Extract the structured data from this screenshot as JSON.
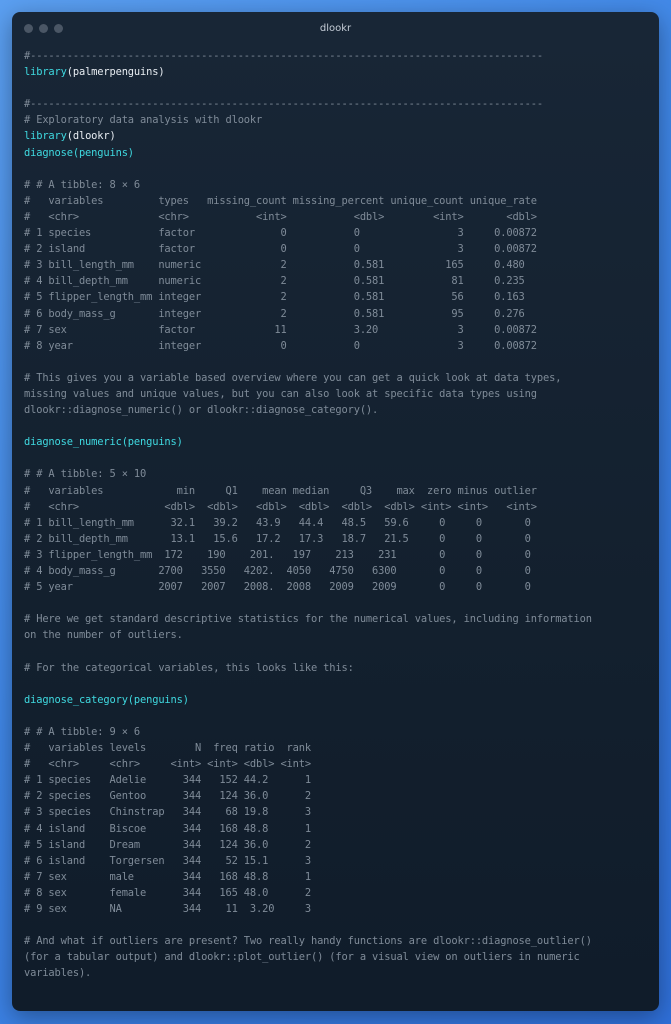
{
  "window": {
    "title": "dlookr"
  },
  "code_lines": [
    {
      "kind": "comment",
      "text": "#------------------------------------------------------------------------------------"
    },
    {
      "kind": "call",
      "fn": "library",
      "arg": "palmerpenguins",
      "fn_color": "cyan"
    },
    {
      "kind": "blank",
      "text": ""
    },
    {
      "kind": "comment",
      "text": "#------------------------------------------------------------------------------------"
    },
    {
      "kind": "comment",
      "text": "# Exploratory data analysis with dlookr"
    },
    {
      "kind": "call",
      "fn": "library",
      "arg": "dlookr",
      "fn_color": "cyan"
    },
    {
      "kind": "call_full",
      "text": "diagnose(penguins)"
    },
    {
      "kind": "blank",
      "text": ""
    },
    {
      "kind": "comment",
      "text": "# # A tibble: 8 × 6"
    },
    {
      "kind": "comment",
      "text": "#   variables         types   missing_count missing_percent unique_count unique_rate"
    },
    {
      "kind": "comment",
      "text": "#   <chr>             <chr>           <int>           <dbl>        <int>       <dbl>"
    },
    {
      "kind": "comment",
      "text": "# 1 species           factor              0           0                3     0.00872"
    },
    {
      "kind": "comment",
      "text": "# 2 island            factor              0           0                3     0.00872"
    },
    {
      "kind": "comment",
      "text": "# 3 bill_length_mm    numeric             2           0.581          165     0.480"
    },
    {
      "kind": "comment",
      "text": "# 4 bill_depth_mm     numeric             2           0.581           81     0.235"
    },
    {
      "kind": "comment",
      "text": "# 5 flipper_length_mm integer             2           0.581           56     0.163"
    },
    {
      "kind": "comment",
      "text": "# 6 body_mass_g       integer             2           0.581           95     0.276"
    },
    {
      "kind": "comment",
      "text": "# 7 sex               factor             11           3.20             3     0.00872"
    },
    {
      "kind": "comment",
      "text": "# 8 year              integer             0           0                3     0.00872"
    },
    {
      "kind": "blank",
      "text": ""
    },
    {
      "kind": "comment",
      "text": "# This gives you a variable based overview where you can get a quick look at data types,"
    },
    {
      "kind": "comment",
      "text": "missing values and unique values, but you can also look at specific data types using"
    },
    {
      "kind": "comment",
      "text": "dlookr::diagnose_numeric() or dlookr::diagnose_category()."
    },
    {
      "kind": "blank",
      "text": ""
    },
    {
      "kind": "call_full",
      "text": "diagnose_numeric(penguins)"
    },
    {
      "kind": "blank",
      "text": ""
    },
    {
      "kind": "comment",
      "text": "# # A tibble: 5 × 10"
    },
    {
      "kind": "comment",
      "text": "#   variables            min     Q1    mean median     Q3    max  zero minus outlier"
    },
    {
      "kind": "comment",
      "text": "#   <chr>              <dbl>  <dbl>   <dbl>  <dbl>  <dbl>  <dbl> <int> <int>   <int>"
    },
    {
      "kind": "comment",
      "text": "# 1 bill_length_mm      32.1   39.2   43.9   44.4   48.5   59.6     0     0       0"
    },
    {
      "kind": "comment",
      "text": "# 2 bill_depth_mm       13.1   15.6   17.2   17.3   18.7   21.5     0     0       0"
    },
    {
      "kind": "comment",
      "text": "# 3 flipper_length_mm  172    190    201.   197    213    231       0     0       0"
    },
    {
      "kind": "comment",
      "text": "# 4 body_mass_g       2700   3550   4202.  4050   4750   6300       0     0       0"
    },
    {
      "kind": "comment",
      "text": "# 5 year              2007   2007   2008.  2008   2009   2009       0     0       0"
    },
    {
      "kind": "blank",
      "text": ""
    },
    {
      "kind": "comment",
      "text": "# Here we get standard descriptive statistics for the numerical values, including information"
    },
    {
      "kind": "comment",
      "text": "on the number of outliers."
    },
    {
      "kind": "blank",
      "text": ""
    },
    {
      "kind": "comment",
      "text": "# For the categorical variables, this looks like this:"
    },
    {
      "kind": "blank",
      "text": ""
    },
    {
      "kind": "call_full",
      "text": "diagnose_category(penguins)"
    },
    {
      "kind": "blank",
      "text": ""
    },
    {
      "kind": "comment",
      "text": "# # A tibble: 9 × 6"
    },
    {
      "kind": "comment",
      "text": "#   variables levels        N  freq ratio  rank"
    },
    {
      "kind": "comment",
      "text": "#   <chr>     <chr>     <int> <int> <dbl> <int>"
    },
    {
      "kind": "comment",
      "text": "# 1 species   Adelie      344   152 44.2      1"
    },
    {
      "kind": "comment",
      "text": "# 2 species   Gentoo      344   124 36.0      2"
    },
    {
      "kind": "comment",
      "text": "# 3 species   Chinstrap   344    68 19.8      3"
    },
    {
      "kind": "comment",
      "text": "# 4 island    Biscoe      344   168 48.8      1"
    },
    {
      "kind": "comment",
      "text": "# 5 island    Dream       344   124 36.0      2"
    },
    {
      "kind": "comment",
      "text": "# 6 island    Torgersen   344    52 15.1      3"
    },
    {
      "kind": "comment",
      "text": "# 7 sex       male        344   168 48.8      1"
    },
    {
      "kind": "comment",
      "text": "# 8 sex       female      344   165 48.0      2"
    },
    {
      "kind": "comment",
      "text": "# 9 sex       NA          344    11  3.20     3"
    },
    {
      "kind": "blank",
      "text": ""
    },
    {
      "kind": "comment",
      "text": "# And what if outliers are present? Two really handy functions are dlookr::diagnose_outlier()"
    },
    {
      "kind": "comment",
      "text": "(for a tabular output) and dlookr::plot_outlier() (for a visual view on outliers in numeric"
    },
    {
      "kind": "comment",
      "text": "variables)."
    }
  ]
}
